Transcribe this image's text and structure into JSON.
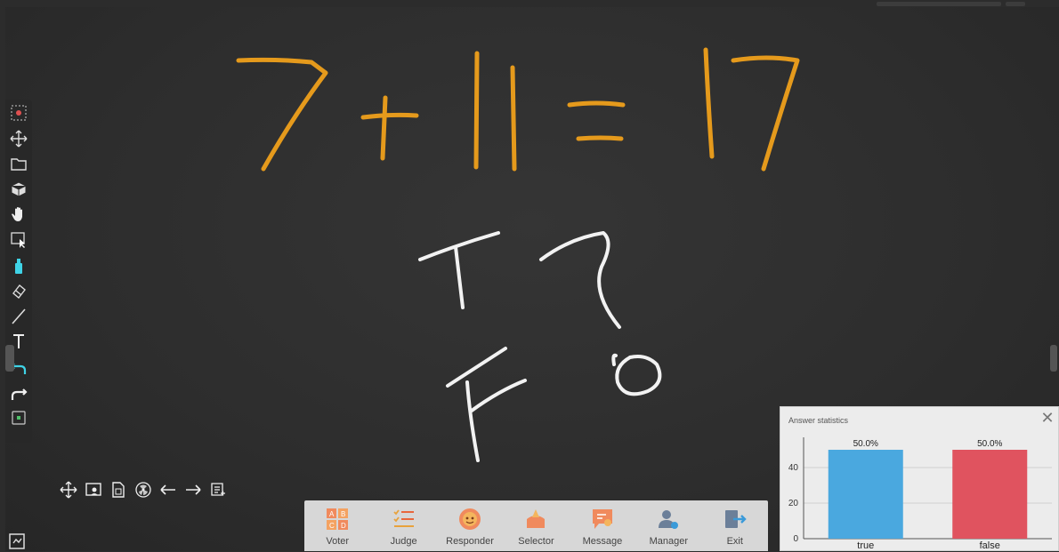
{
  "toolbar": {
    "tools": [
      {
        "name": "record-icon",
        "glyph": "⬚"
      },
      {
        "name": "move-icon",
        "glyph": "✥"
      },
      {
        "name": "folder-icon",
        "glyph": "🗀"
      },
      {
        "name": "box-icon",
        "glyph": "⬢"
      },
      {
        "name": "hand-icon",
        "glyph": "✋"
      },
      {
        "name": "select-icon",
        "glyph": "⬚"
      },
      {
        "name": "pen-icon",
        "glyph": "▮"
      },
      {
        "name": "eraser-icon",
        "glyph": "◇"
      },
      {
        "name": "line-icon",
        "glyph": "╱"
      },
      {
        "name": "text-icon",
        "glyph": "T"
      },
      {
        "name": "undo-icon",
        "glyph": "↶"
      },
      {
        "name": "redo-icon",
        "glyph": "↷"
      },
      {
        "name": "page-icon",
        "glyph": "▢"
      }
    ]
  },
  "bottom_tools": [
    {
      "name": "move-icon"
    },
    {
      "name": "whiteboard-icon"
    },
    {
      "name": "document-icon"
    },
    {
      "name": "radiation-icon"
    },
    {
      "name": "arrow-left-icon"
    },
    {
      "name": "arrow-right-icon"
    },
    {
      "name": "notes-icon"
    }
  ],
  "dock": [
    {
      "label": "Voter",
      "icon": "voter-icon",
      "color": "#e8673c"
    },
    {
      "label": "Judge",
      "icon": "judge-icon",
      "color": "#e8a23c"
    },
    {
      "label": "Responder",
      "icon": "responder-icon",
      "color": "#e8673c"
    },
    {
      "label": "Selector",
      "icon": "selector-icon",
      "color": "#e8673c"
    },
    {
      "label": "Message",
      "icon": "message-icon",
      "color": "#e8673c"
    },
    {
      "label": "Manager",
      "icon": "manager-icon",
      "color": "#556b8a"
    },
    {
      "label": "Exit",
      "icon": "exit-icon",
      "color": "#556b8a"
    }
  ],
  "stats": {
    "title": "Answer statistics",
    "close_icon": "close-icon"
  },
  "chart_data": {
    "type": "bar",
    "categories": [
      "true",
      "false"
    ],
    "values": [
      50,
      50
    ],
    "data_labels": [
      "50.0%",
      "50.0%"
    ],
    "colors": [
      "#4aa8df",
      "#e0535f"
    ],
    "ylim": [
      0,
      55
    ],
    "yticks": [
      0,
      20,
      40
    ],
    "grid": true
  }
}
